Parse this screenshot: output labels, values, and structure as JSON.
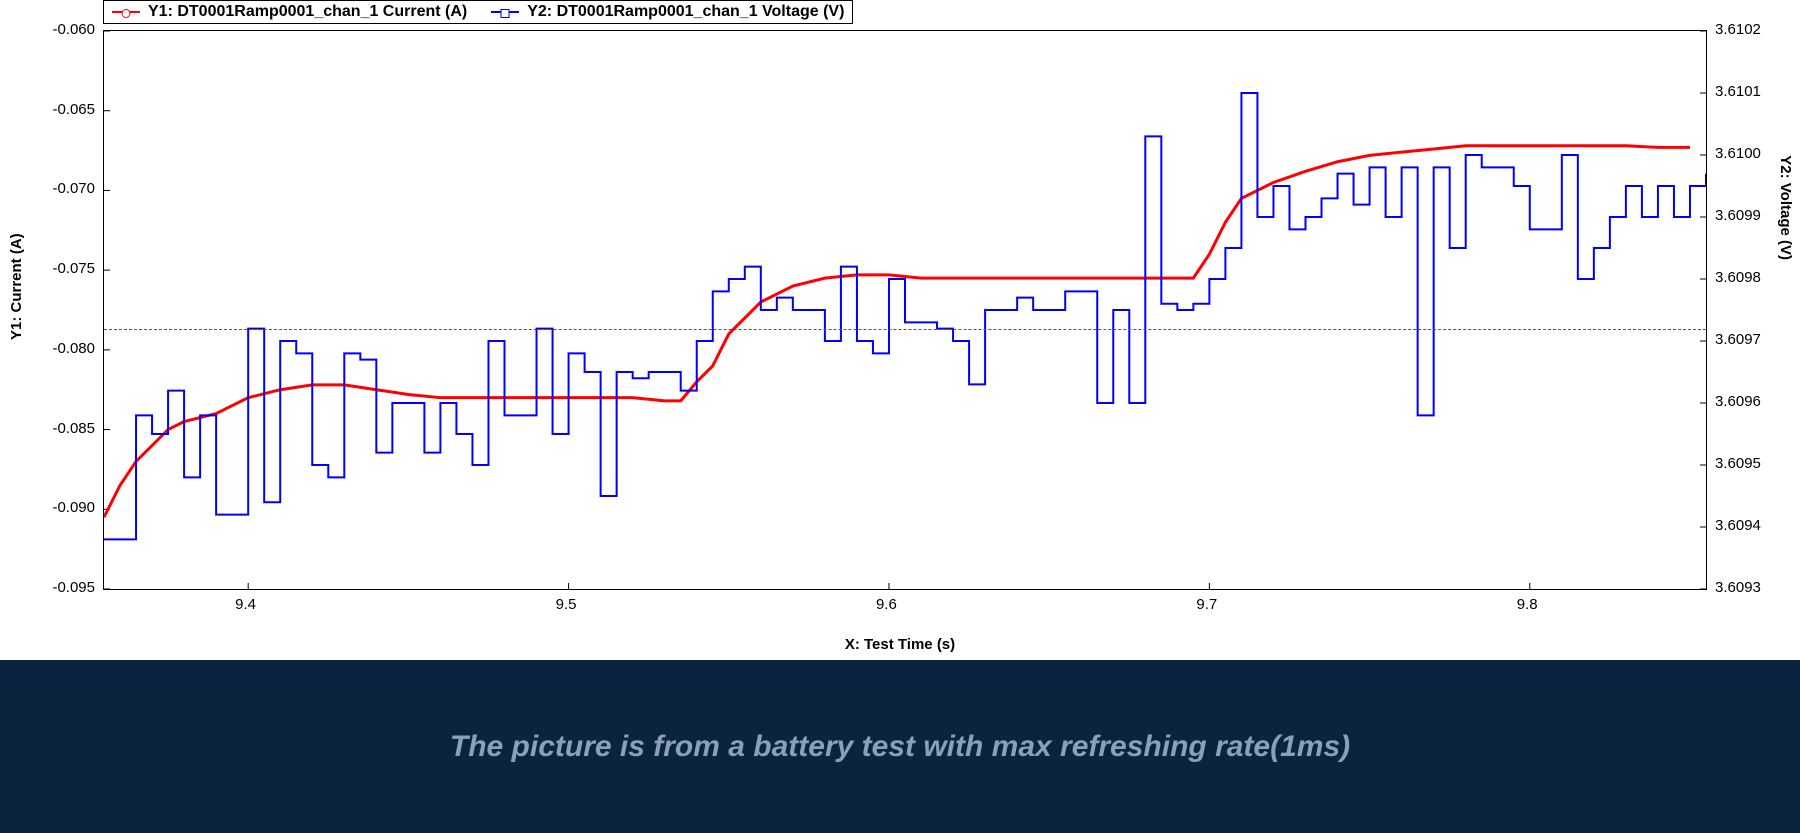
{
  "legend": {
    "y1": "Y1: DT0001Ramp0001_chan_1 Current (A)",
    "y2": "Y2: DT0001Ramp0001_chan_1 Voltage (V)"
  },
  "axis_labels": {
    "y1": "Y1: Current (A)",
    "y2": "Y2: Voltage (V)",
    "x": "X: Test Time (s)"
  },
  "caption": "The picture is from a battery test with max refreshing rate(1ms)",
  "chart_data": {
    "type": "line",
    "xlabel": "Test Time (s)",
    "xlim": [
      9.355,
      9.855
    ],
    "xticks": [
      9.4,
      9.5,
      9.6,
      9.7,
      9.8
    ],
    "y1": {
      "label": "Current (A)",
      "lim": [
        -0.095,
        -0.06
      ],
      "ticks": [
        -0.06,
        -0.065,
        -0.07,
        -0.075,
        -0.08,
        -0.085,
        -0.09,
        -0.095
      ],
      "color": "#ff0000"
    },
    "y2": {
      "label": "Voltage (V)",
      "lim": [
        3.6093,
        3.6102
      ],
      "ticks": [
        3.6093,
        3.6094,
        3.6095,
        3.6096,
        3.6097,
        3.6098,
        3.6099,
        3.61,
        3.6101,
        3.6102
      ],
      "color": "#0000ff"
    },
    "reference_line_y2": 3.60972,
    "series": [
      {
        "name": "Current (A)",
        "axis": "y1",
        "style": "line+marker",
        "x": [
          9.355,
          9.36,
          9.365,
          9.37,
          9.375,
          9.38,
          9.39,
          9.4,
          9.41,
          9.42,
          9.43,
          9.44,
          9.45,
          9.46,
          9.47,
          9.48,
          9.49,
          9.5,
          9.51,
          9.52,
          9.53,
          9.535,
          9.54,
          9.545,
          9.55,
          9.56,
          9.57,
          9.58,
          9.59,
          9.6,
          9.61,
          9.62,
          9.63,
          9.64,
          9.65,
          9.66,
          9.67,
          9.68,
          9.69,
          9.695,
          9.7,
          9.705,
          9.71,
          9.72,
          9.73,
          9.74,
          9.75,
          9.76,
          9.77,
          9.78,
          9.79,
          9.8,
          9.81,
          9.82,
          9.83,
          9.84,
          9.85
        ],
        "values": [
          -0.0905,
          -0.0885,
          -0.087,
          -0.086,
          -0.085,
          -0.0845,
          -0.084,
          -0.083,
          -0.0825,
          -0.0822,
          -0.0822,
          -0.0825,
          -0.0828,
          -0.083,
          -0.083,
          -0.083,
          -0.083,
          -0.083,
          -0.083,
          -0.083,
          -0.0832,
          -0.0832,
          -0.082,
          -0.081,
          -0.079,
          -0.077,
          -0.076,
          -0.0755,
          -0.0753,
          -0.0753,
          -0.0755,
          -0.0755,
          -0.0755,
          -0.0755,
          -0.0755,
          -0.0755,
          -0.0755,
          -0.0755,
          -0.0755,
          -0.0755,
          -0.074,
          -0.072,
          -0.0705,
          -0.0695,
          -0.0688,
          -0.0682,
          -0.0678,
          -0.0676,
          -0.0674,
          -0.0672,
          -0.0672,
          -0.0672,
          -0.0672,
          -0.0672,
          -0.0672,
          -0.0673,
          -0.0673
        ]
      },
      {
        "name": "Voltage (V)",
        "axis": "y2",
        "style": "step",
        "x": [
          9.355,
          9.36,
          9.365,
          9.37,
          9.375,
          9.38,
          9.385,
          9.39,
          9.395,
          9.4,
          9.405,
          9.41,
          9.415,
          9.42,
          9.425,
          9.43,
          9.435,
          9.44,
          9.445,
          9.45,
          9.455,
          9.46,
          9.465,
          9.47,
          9.475,
          9.48,
          9.485,
          9.49,
          9.495,
          9.5,
          9.505,
          9.51,
          9.515,
          9.52,
          9.525,
          9.53,
          9.535,
          9.54,
          9.545,
          9.55,
          9.555,
          9.56,
          9.565,
          9.57,
          9.575,
          9.58,
          9.585,
          9.59,
          9.595,
          9.6,
          9.605,
          9.61,
          9.615,
          9.62,
          9.625,
          9.63,
          9.635,
          9.64,
          9.645,
          9.65,
          9.655,
          9.66,
          9.665,
          9.67,
          9.675,
          9.68,
          9.685,
          9.69,
          9.695,
          9.7,
          9.705,
          9.71,
          9.715,
          9.72,
          9.725,
          9.73,
          9.735,
          9.74,
          9.745,
          9.75,
          9.755,
          9.76,
          9.765,
          9.77,
          9.775,
          9.78,
          9.785,
          9.79,
          9.795,
          9.8,
          9.805,
          9.81,
          9.815,
          9.82,
          9.825,
          9.83,
          9.835,
          9.84,
          9.845,
          9.85,
          9.855
        ],
        "values": [
          3.60938,
          3.60938,
          3.60958,
          3.60955,
          3.60962,
          3.60948,
          3.60958,
          3.60942,
          3.60942,
          3.60972,
          3.60944,
          3.6097,
          3.60968,
          3.6095,
          3.60948,
          3.60968,
          3.60967,
          3.60952,
          3.6096,
          3.6096,
          3.60952,
          3.6096,
          3.60955,
          3.6095,
          3.6097,
          3.60958,
          3.60958,
          3.60972,
          3.60955,
          3.60968,
          3.60965,
          3.60945,
          3.60965,
          3.60964,
          3.60965,
          3.60965,
          3.60962,
          3.6097,
          3.60978,
          3.6098,
          3.60982,
          3.60975,
          3.60977,
          3.60975,
          3.60975,
          3.6097,
          3.60982,
          3.6097,
          3.60968,
          3.6098,
          3.60973,
          3.60973,
          3.60972,
          3.6097,
          3.60963,
          3.60975,
          3.60975,
          3.60977,
          3.60975,
          3.60975,
          3.60978,
          3.60978,
          3.6096,
          3.60975,
          3.6096,
          3.61003,
          3.60976,
          3.60975,
          3.60976,
          3.6098,
          3.60985,
          3.6101,
          3.6099,
          3.60995,
          3.60988,
          3.6099,
          3.60993,
          3.60997,
          3.60992,
          3.60998,
          3.6099,
          3.60998,
          3.60958,
          3.60998,
          3.60985,
          3.61,
          3.60998,
          3.60998,
          3.60995,
          3.60988,
          3.60988,
          3.61,
          3.6098,
          3.60985,
          3.6099,
          3.60995,
          3.6099,
          3.60995,
          3.6099,
          3.60995,
          3.60997
        ]
      }
    ]
  }
}
